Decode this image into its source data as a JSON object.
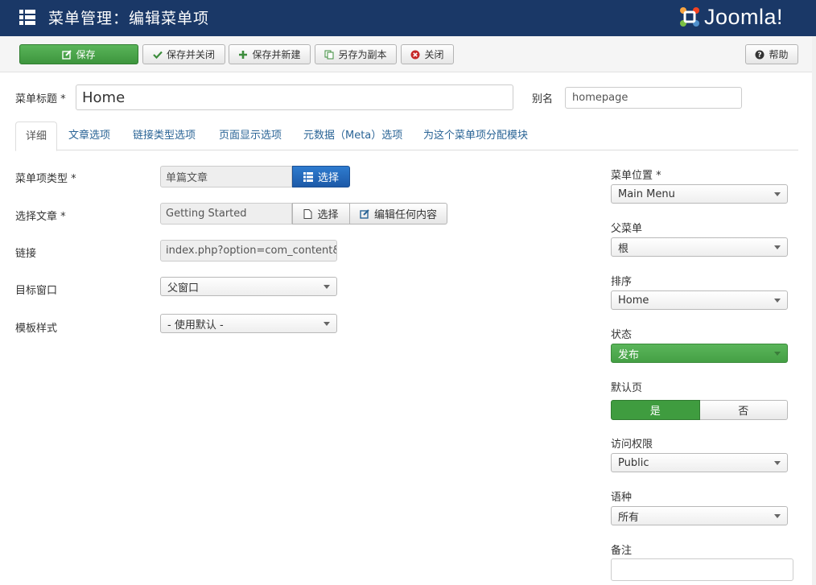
{
  "header": {
    "title": "菜单管理：编辑菜单项",
    "logo_text": "Joomla!"
  },
  "toolbar": {
    "save": "保存",
    "save_close": "保存并关闭",
    "save_new": "保存并新建",
    "save_copy": "另存为副本",
    "close": "关闭",
    "help": "帮助"
  },
  "form": {
    "title_label": "菜单标题 *",
    "title_value": "Home",
    "alias_label": "别名",
    "alias_value": "homepage"
  },
  "tabs": [
    "详细",
    "文章选项",
    "链接类型选项",
    "页面显示选项",
    "元数据（Meta）选项",
    "为这个菜单项分配模块"
  ],
  "details": {
    "type_label": "菜单项类型 *",
    "type_value": "单篇文章",
    "type_button": "选择",
    "article_label": "选择文章 *",
    "article_value": "Getting Started",
    "article_select": "选择",
    "article_edit": "编辑任何内容",
    "link_label": "链接",
    "link_value": "index.php?option=com_content&view=article",
    "target_label": "目标窗口",
    "target_value": "父窗口",
    "template_label": "模板样式",
    "template_value": "- 使用默认 -"
  },
  "sidebar": {
    "menu_label": "菜单位置 *",
    "menu_value": "Main Menu",
    "parent_label": "父菜单",
    "parent_value": "根",
    "order_label": "排序",
    "order_value": "Home",
    "status_label": "状态",
    "status_value": "发布",
    "default_label": "默认页",
    "default_yes": "是",
    "default_no": "否",
    "access_label": "访问权限",
    "access_value": "Public",
    "language_label": "语种",
    "language_value": "所有",
    "note_label": "备注"
  },
  "colors": {
    "header": "#1a3867",
    "save_green": "#46a546",
    "link_blue": "#2a6496"
  }
}
